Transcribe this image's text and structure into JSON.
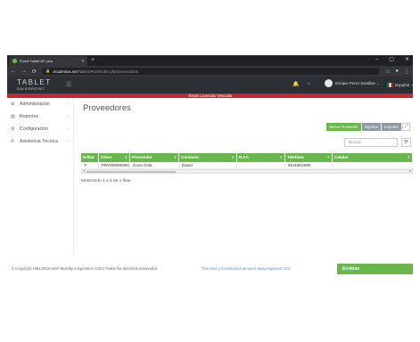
{
  "browser": {
    "tab_title": "Portal Tablet SF plus",
    "url_host": "cloudmbox.net",
    "url_path": "/TabletSPoint/index.php/proveedores"
  },
  "header": {
    "logo_main": "TABLET",
    "logo_sub": "SALESPOINT",
    "user_name": "Enrique Perez Santillan",
    "language": "Español"
  },
  "banner": "Tienes Licencias Vencidas",
  "sidebar": {
    "items": [
      {
        "label": "Administración",
        "icon": "gear-icon"
      },
      {
        "label": "Reportes",
        "icon": "chart-icon"
      },
      {
        "label": "Configuración",
        "icon": "cogs-icon"
      },
      {
        "label": "Asistencia Técnica",
        "icon": "phone-icon"
      }
    ]
  },
  "main": {
    "title": "Proveedores",
    "buttons": {
      "new": "Nuevo Proveedor",
      "import": "Importar",
      "export": "Exportar"
    },
    "search_placeholder": "Buscar",
    "table": {
      "headers": [
        "Editar",
        "Clave",
        "Proveedor",
        "Contacto",
        "R.F.C",
        "Telefono",
        "Celular"
      ],
      "rows": [
        [
          "",
          "PRV000000001",
          "Coca Cola",
          "David",
          "",
          "5511681900",
          ""
        ]
      ]
    },
    "showing": "Mostrando 1 a 1 de 1 filas"
  },
  "footer": {
    "copyright": "© Copyright 1991-2019 MSP Mobility Corporation (USA) Todos los derechos reservados",
    "terms": "Términos y Condiciones de uso  |  www.mspmovil.com",
    "brand": "Ecvitme"
  },
  "colors": {
    "accent_green": "#6ab64c",
    "banner_red": "#c9252c",
    "header_dark": "#2c3034"
  }
}
